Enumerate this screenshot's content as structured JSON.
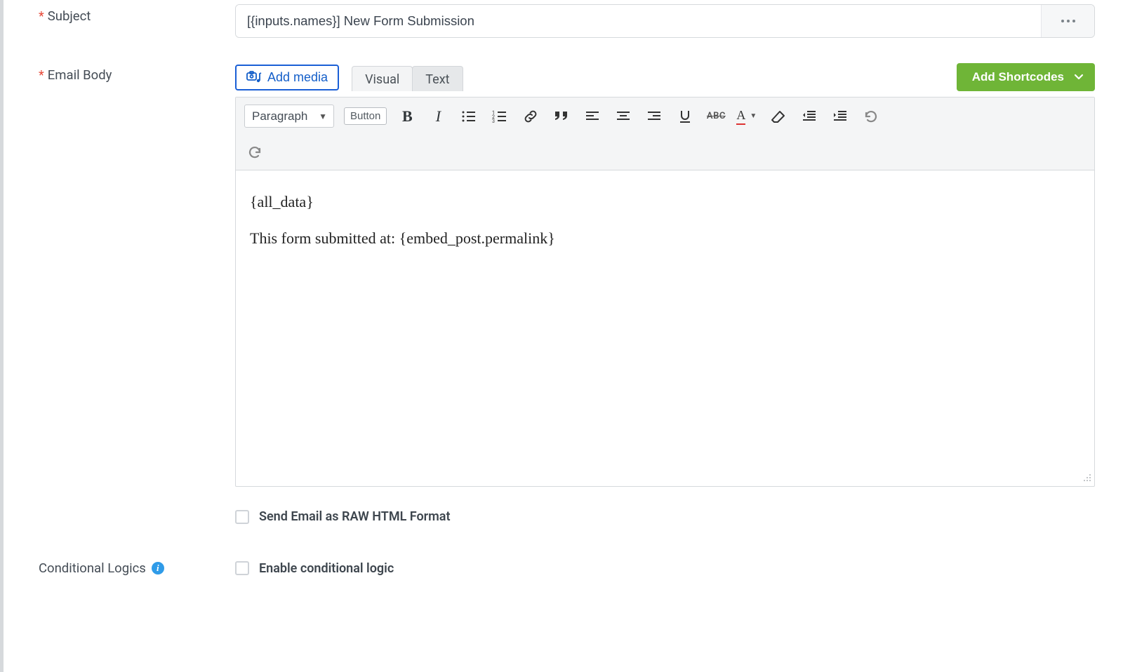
{
  "subject": {
    "label": "Subject",
    "value": "[{inputs.names}] New Form Submission"
  },
  "email_body": {
    "label": "Email Body",
    "add_media_label": "Add media",
    "tabs": {
      "visual": "Visual",
      "text": "Text"
    },
    "shortcodes_label": "Add Shortcodes",
    "toolbar": {
      "format": "Paragraph",
      "button_label": "Button"
    },
    "content_line1": "{all_data}",
    "content_line2": "This form submitted at: {embed_post.permalink}"
  },
  "raw_html": {
    "label": "Send Email as RAW HTML Format",
    "checked": false
  },
  "conditional": {
    "section_label": "Conditional Logics",
    "enable_label": "Enable conditional logic",
    "checked": false
  }
}
